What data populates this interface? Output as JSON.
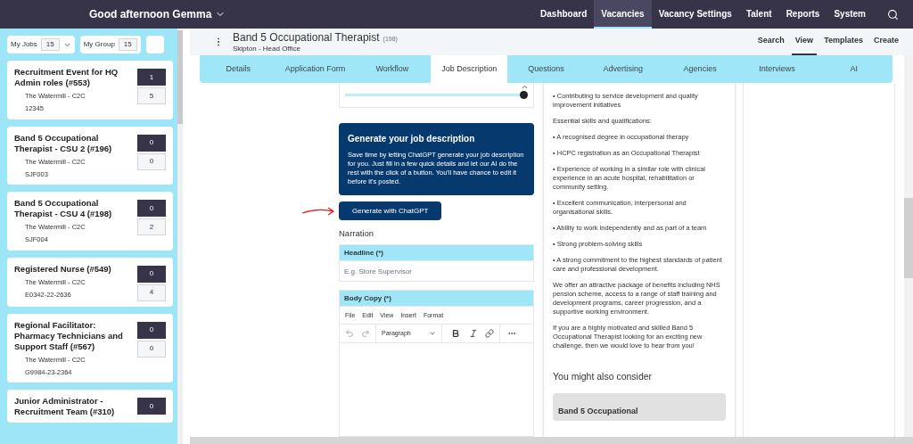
{
  "topbar": {
    "greeting": "Good afternoon Gemma",
    "nav": [
      {
        "label": "Dashboard",
        "selected": false
      },
      {
        "label": "Vacancies",
        "selected": true
      },
      {
        "label": "Vacancy Settings",
        "selected": false
      },
      {
        "label": "Talent",
        "selected": false
      },
      {
        "label": "Reports",
        "selected": false
      },
      {
        "label": "System",
        "selected": false
      }
    ]
  },
  "sidebar": {
    "filters": [
      {
        "label": "My Jobs",
        "count": "15",
        "dropdown": true
      },
      {
        "label": "My Group",
        "count": "15",
        "dropdown": false
      }
    ],
    "jobs": [
      {
        "title": "Recruitment Event for HQ Admin roles (#553)",
        "location": "The Watermill - C2C",
        "ref": "12345",
        "counts": [
          "1",
          "5"
        ]
      },
      {
        "title": "Band 5 Occupational Therapist - CSU 2 (#196)",
        "location": "The Watermill - C2C",
        "ref": "SJF003",
        "counts": [
          "0",
          "0"
        ]
      },
      {
        "title": "Band 5 Occupational Therapist - CSU 4 (#198)",
        "location": "The Watermill - C2C",
        "ref": "SJF004",
        "counts": [
          "0",
          "2"
        ]
      },
      {
        "title": "Registered Nurse (#549)",
        "location": "The Watermill - C2C",
        "ref": "E0342-22-2636",
        "counts": [
          "0",
          "4"
        ]
      },
      {
        "title": "Regional Facilitator: Pharmacy Technicians and Support Staff (#567)",
        "location": "The Watermill - C2C",
        "ref": "G9984-23-2364",
        "counts": [
          "0",
          "0"
        ]
      },
      {
        "title": "Junior Administrator - Recruitment Team (#310)",
        "counts": [
          "0"
        ]
      }
    ]
  },
  "header": {
    "title": "Band 5 Occupational Therapist",
    "count": "(198)",
    "subtitle": "Skipton - Head Office",
    "actions": [
      {
        "label": "Search",
        "selected": false
      },
      {
        "label": "View",
        "selected": true
      },
      {
        "label": "Templates",
        "selected": false
      },
      {
        "label": "Create",
        "selected": false
      }
    ]
  },
  "tabs": [
    {
      "label": "Details",
      "selected": false
    },
    {
      "label": "Application Form",
      "selected": false
    },
    {
      "label": "Workflow",
      "selected": false
    },
    {
      "label": "Job Description",
      "selected": true
    },
    {
      "label": "Questions",
      "selected": false
    },
    {
      "label": "Advertising",
      "selected": false
    },
    {
      "label": "Agencies",
      "selected": false
    },
    {
      "label": "Interviews",
      "selected": false
    },
    {
      "label": "AI",
      "selected": false
    }
  ],
  "form": {
    "slider": {
      "level": 1
    },
    "promo": {
      "title": "Generate your job description",
      "text": "Save time by letting ChatGPT generate your job description for you. Just fill in a few quick details and let our AI do the rest with the click of a button. You'll have chance to edit it before it's posted."
    },
    "generate_button": "Generate with ChatGPT",
    "section_title": "Narration",
    "headline": {
      "label": "Headline (*)",
      "placeholder": "E.g. Store Supervisor"
    },
    "body_copy": {
      "label": "Body Copy (*)",
      "menu": [
        "File",
        "Edit",
        "View",
        "Insert",
        "Format"
      ],
      "block_format": "Paragraph"
    }
  },
  "description": {
    "paragraphs": [
      "• Contributing to service development and quality improvement initiatives",
      "Essential skills and qualifications:",
      "• A recognised degree in occupational therapy",
      "• HCPC registration as an Occupational Therapist",
      "• Experience of working in a similar role with clinical experience in an acute hospital, rehabilitation or community setting.",
      "• Excellent communication, interpersonal and organisational skills.",
      "• Ability to work independently and as part of a team",
      "• Strong problem-solving skills",
      "• A strong commitment to the highest standards of patient care and professional development.",
      "We offer an attractive package of benefits including NHS pension scheme, access to a range of staff training and development programs, career progression, and a supportive working environment.",
      "If you are a highly motivated and skilled Band 5 Occupational Therapist looking for an exciting new challenge, then we would love to hear from you!"
    ],
    "also_consider": {
      "title": "You might also consider",
      "cards": [
        "Band 5 Occupational"
      ]
    }
  }
}
